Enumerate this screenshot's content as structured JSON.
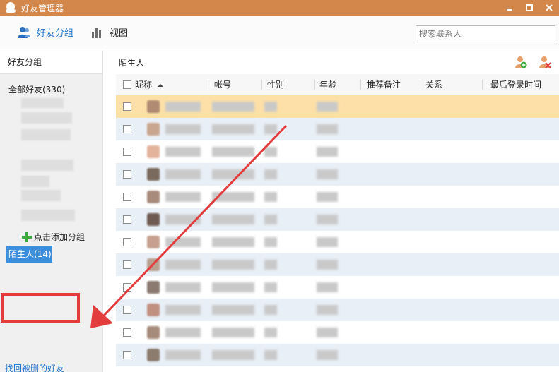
{
  "window": {
    "title": "好友管理器"
  },
  "toolbar": {
    "friend_groups_label": "好友分组",
    "view_label": "视图",
    "search_placeholder": "搜索联系人"
  },
  "sidebar": {
    "header": "好友分组",
    "all_friends": "全部好友(330)",
    "add_group": "点击添加分组",
    "strangers": "陌生人(14)",
    "recover_deleted": "找回被删的好友"
  },
  "main": {
    "title": "陌生人",
    "columns": [
      "昵称",
      "帐号",
      "性别",
      "年龄",
      "推荐备注",
      "关系",
      "最后登录时间"
    ]
  },
  "colors": {
    "titlebar": "#d4874b",
    "accent": "#1d6fc9",
    "selected_row": "#fde0a8",
    "alt_row": "#e9eff6",
    "highlight_box": "#e23c3c"
  }
}
